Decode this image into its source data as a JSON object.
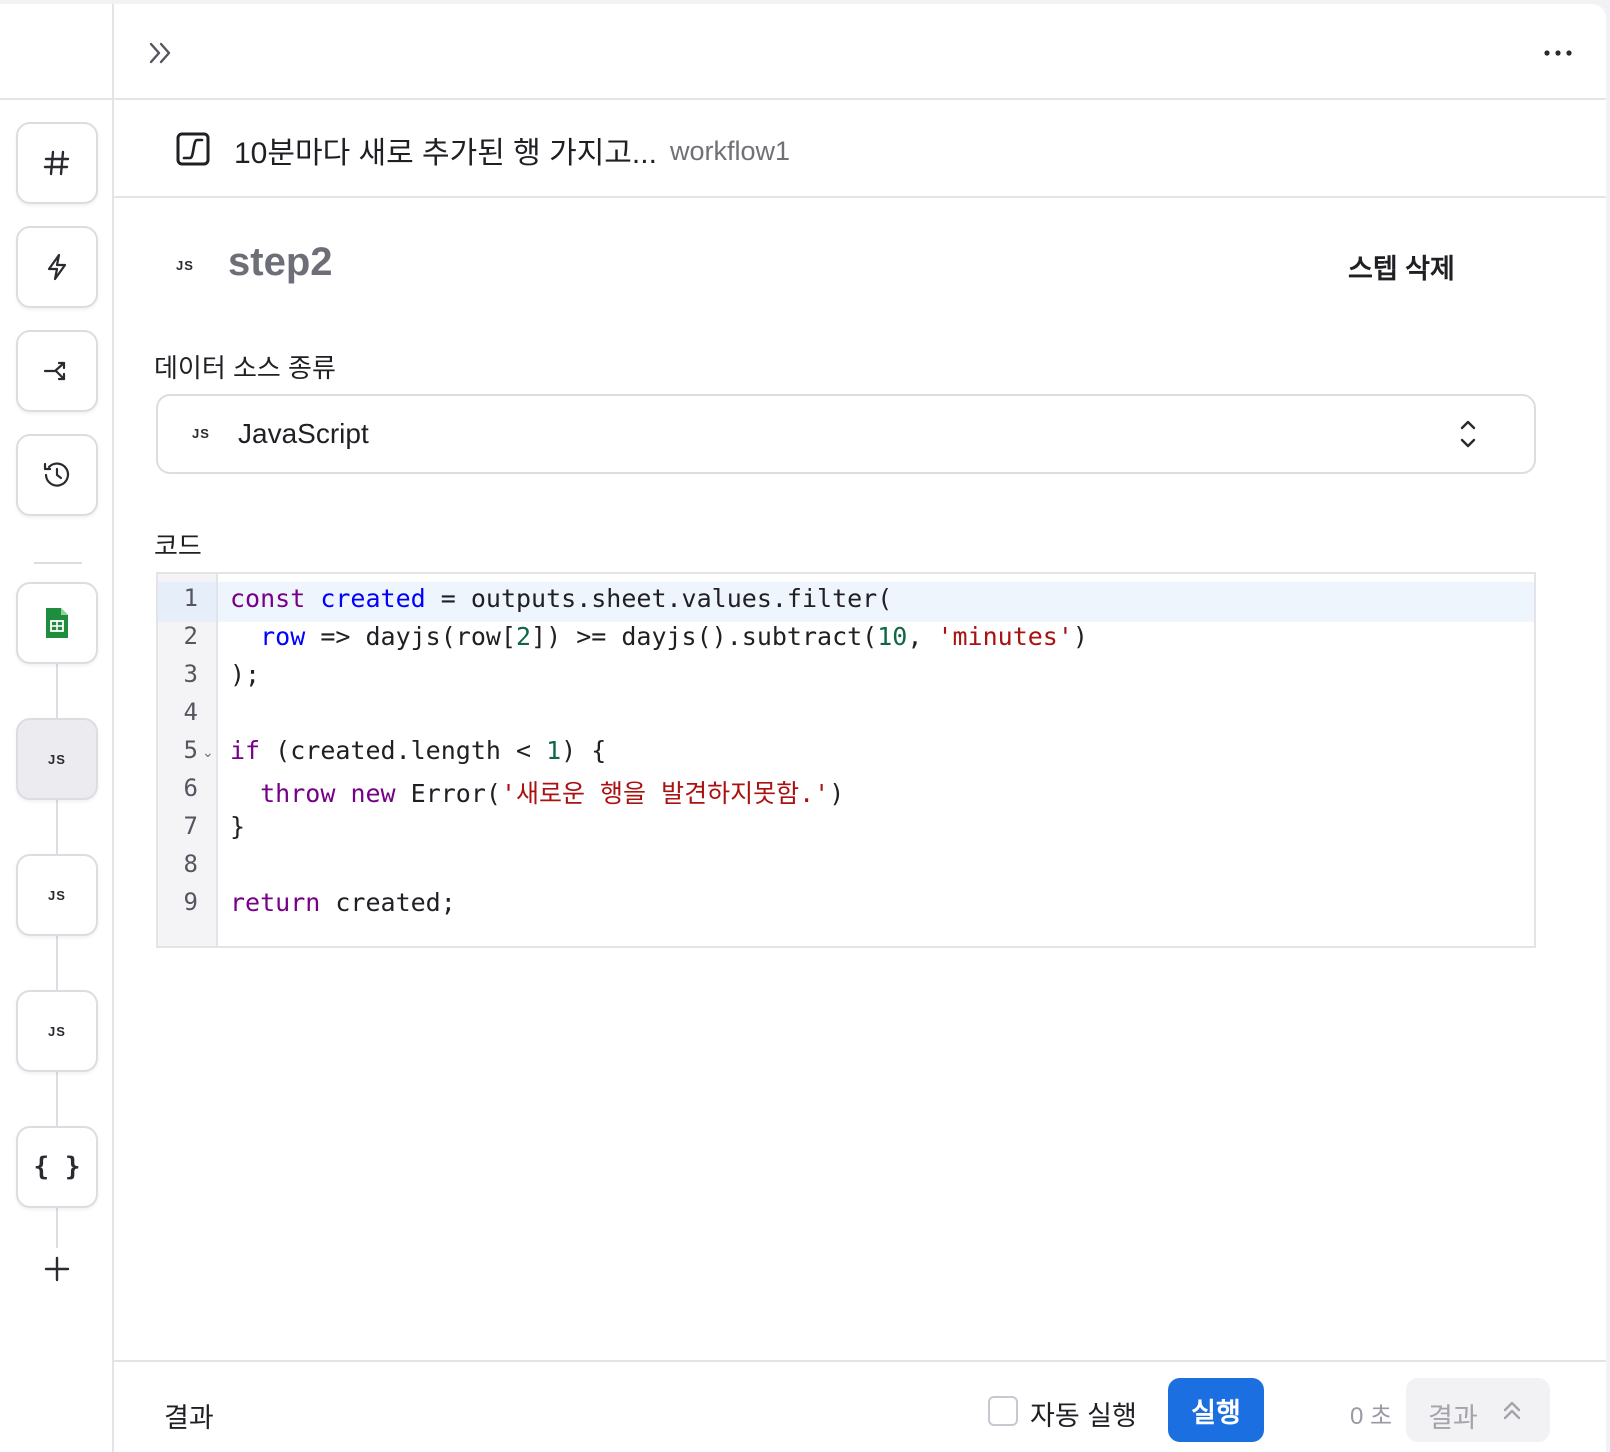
{
  "rail": {
    "items": [
      {
        "name": "hash",
        "icon": "hash-icon"
      },
      {
        "name": "trigger",
        "icon": "lightning-icon"
      },
      {
        "name": "branch",
        "icon": "shuffle-icon"
      },
      {
        "name": "history",
        "icon": "history-icon"
      }
    ],
    "steps": [
      {
        "label": "JS",
        "icon": "google-sheets-icon"
      },
      {
        "label": "JS",
        "active": true
      },
      {
        "label": "JS"
      },
      {
        "label": "JS"
      },
      {
        "label": "{ }",
        "icon": "braces-icon"
      }
    ]
  },
  "workflow": {
    "title": "10분마다 새로 추가된 행 가지고...",
    "id": "workflow1"
  },
  "step": {
    "badge": "JS",
    "name": "step2",
    "delete_label": "스텝 삭제"
  },
  "data_source": {
    "label": "데이터 소스 종류",
    "badge": "JS",
    "value": "JavaScript"
  },
  "code": {
    "label": "코드",
    "line_numbers": [
      "1",
      "2",
      "3",
      "4",
      "5",
      "6",
      "7",
      "8",
      "9"
    ],
    "lines": [
      "const created = outputs.sheet.values.filter(",
      "  row => dayjs(row[2]) >= dayjs().subtract(10, 'minutes')",
      ");",
      "",
      "if (created.length < 1) {",
      "  throw new Error('새로운 행을 발견하지못함.')",
      "}",
      "",
      "return created;"
    ]
  },
  "footer": {
    "result_label": "결과",
    "auto_run_label": "자동 실행",
    "auto_run_checked": false,
    "run_label": "실행",
    "elapsed": "0 초",
    "result_button": "결과"
  },
  "colors": {
    "accent": "#1b6fe0",
    "sheets_green": "#1e8e3e"
  }
}
